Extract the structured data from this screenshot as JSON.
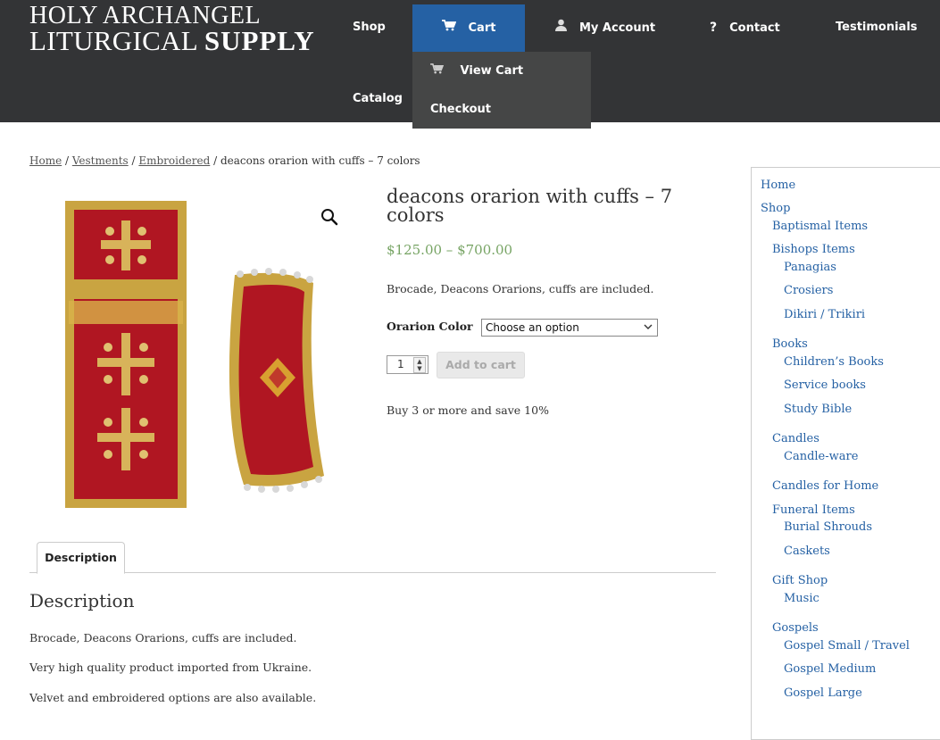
{
  "header": {
    "logo_line1": "HOLY ARCHANGEL",
    "logo_line2_regular": "LITURGICAL ",
    "logo_line2_bold": "SUPPLY",
    "nav": {
      "shop": "Shop",
      "cart": "Cart",
      "my_account": "My Account",
      "contact": "Contact",
      "testimonials": "Testimonials",
      "catalog": "Catalog"
    },
    "cart_dropdown": {
      "view_cart": "View Cart",
      "checkout": "Checkout"
    }
  },
  "breadcrumb": {
    "home": "Home",
    "sep": " / ",
    "vestments": "Vestments",
    "embroidered": "Embroidered",
    "current": "deacons orarion with cuffs – 7 colors"
  },
  "product": {
    "title": "deacons orarion with cuffs – 7 colors",
    "price_range": "$125.00 – $700.00",
    "short_description": "Brocade, Deacons Orarions, cuffs are included.",
    "variation_label": "Orarion Color",
    "variation_selected": "Choose an option",
    "quantity": "1",
    "add_to_cart": "Add to cart",
    "promo": "Buy 3 or more and save 10%"
  },
  "tabs": {
    "description_tab": "Description",
    "heading": "Description",
    "paragraphs": [
      "Brocade, Deacons Orarions, cuffs are included.",
      "Very high quality product imported from Ukraine.",
      "Velvet and embroidered options are also available."
    ]
  },
  "sidebar": {
    "categories": [
      {
        "label": "Home",
        "level": 0
      },
      {
        "label": "Shop",
        "level": 0
      },
      {
        "label": "Baptismal Items",
        "level": 1
      },
      {
        "label": "Bishops Items",
        "level": 1
      },
      {
        "label": "Panagias",
        "level": 2
      },
      {
        "label": "Crosiers",
        "level": 2
      },
      {
        "label": "Dikiri / Trikiri",
        "level": 2
      },
      {
        "label": "Books",
        "level": 1
      },
      {
        "label": "Children’s Books",
        "level": 2
      },
      {
        "label": "Service books",
        "level": 2
      },
      {
        "label": "Study Bible",
        "level": 2
      },
      {
        "label": "Candles",
        "level": 1
      },
      {
        "label": "Candle-ware",
        "level": 2
      },
      {
        "label": "Candles for Home",
        "level": 1
      },
      {
        "label": "Funeral Items",
        "level": 1
      },
      {
        "label": "Burial Shrouds",
        "level": 2
      },
      {
        "label": "Caskets",
        "level": 2
      },
      {
        "label": "Gift Shop",
        "level": 1
      },
      {
        "label": "Music",
        "level": 2
      },
      {
        "label": "Gospels",
        "level": 1
      },
      {
        "label": "Gospel Small / Travel",
        "level": 2
      },
      {
        "label": "Gospel Medium",
        "level": 2
      },
      {
        "label": "Gospel Large",
        "level": 2
      }
    ]
  },
  "colors": {
    "header_bg": "#333436",
    "cart_active": "#2561a4",
    "dropdown_bg": "#454646",
    "link": "#2561a4",
    "price": "#77a464"
  },
  "icons": {
    "cart": "cart-icon",
    "user": "user-icon",
    "question": "question-icon",
    "zoom": "magnifier-icon",
    "chevron": "chevron-down-icon"
  }
}
